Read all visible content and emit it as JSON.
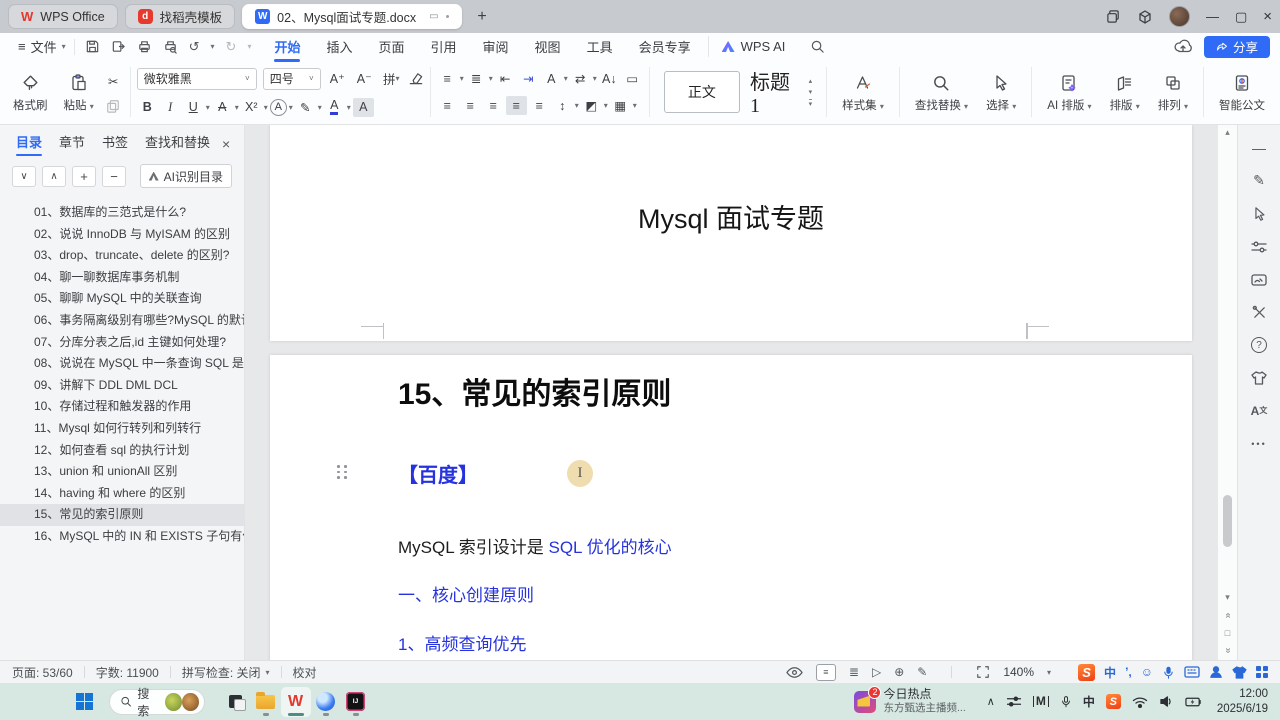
{
  "titlebar": {
    "tabs": [
      {
        "label": "WPS Office",
        "active": false
      },
      {
        "label": "找稻壳模板",
        "active": false
      },
      {
        "label": "02、Mysql面试专题.docx",
        "active": true
      }
    ],
    "share_label": "分享"
  },
  "menubar": {
    "file_label": "文件",
    "items": [
      {
        "label": "开始",
        "active": true
      },
      {
        "label": "插入"
      },
      {
        "label": "页面"
      },
      {
        "label": "引用"
      },
      {
        "label": "审阅"
      },
      {
        "label": "视图"
      },
      {
        "label": "工具"
      },
      {
        "label": "会员专享"
      }
    ],
    "ai_label": "WPS AI"
  },
  "ribbon": {
    "format_painter": "格式刷",
    "paste": "粘贴",
    "font_name": "微软雅黑",
    "font_size": "四号",
    "bold": "B",
    "italic": "I",
    "underline": "U",
    "strike": "A",
    "superscript": "X²",
    "effect": "A",
    "color": "A",
    "shading": "A",
    "grow": "A⁺",
    "shrink": "A⁻",
    "pinyin": "拼",
    "style_normal": "正文",
    "style_heading": "标题 1",
    "style_set": "样式集",
    "find_replace": "查找替换",
    "select": "选择",
    "ai_layout": "AI 排版",
    "layout": "排版",
    "arrange": "排列",
    "smart_doc": "智能公文"
  },
  "sidebar": {
    "tabs": [
      {
        "label": "目录",
        "active": true
      },
      {
        "label": "章节"
      },
      {
        "label": "书签"
      },
      {
        "label": "查找和替换"
      }
    ],
    "ai_button": "AI识别目录",
    "toc_items": [
      {
        "label": "01、数据库的三范式是什么?"
      },
      {
        "label": "02、说说 InnoDB 与 MyISAM 的区别"
      },
      {
        "label": "03、drop、truncate、delete 的区别?"
      },
      {
        "label": "04、聊一聊数据库事务机制"
      },
      {
        "label": "05、聊聊 MySQL 中的关联查询"
      },
      {
        "label": "06、事务隔离级别有哪些?MySQL 的默认..."
      },
      {
        "label": "07、分库分表之后,id 主键如何处理?"
      },
      {
        "label": "08、说说在 MySQL 中一条查询 SQL 是..."
      },
      {
        "label": "09、讲解下 DDL DML DCL"
      },
      {
        "label": "10、存储过程和触发器的作用"
      },
      {
        "label": "11、Mysql 如何行转列和列转行"
      },
      {
        "label": "12、如何查看 sql 的执行计划"
      },
      {
        "label": "13、union 和 unionAll 区别"
      },
      {
        "label": "14、having 和 where 的区别"
      },
      {
        "label": "15、常见的索引原则",
        "selected": true
      },
      {
        "label": "16、MySQL 中的 IN 和 EXISTS 子句有什..."
      }
    ]
  },
  "document": {
    "page1_title": "Mysql 面试专题",
    "heading": "15、常见的索引原则",
    "source_tag": "【百度】",
    "body_prefix": "MySQL 索引设计是 ",
    "body_link": "SQL 优化的核心",
    "section": "一、核心创建原则",
    "subsection": "1、高频查询优先",
    "cursor_glyph": "I"
  },
  "statusbar": {
    "page_info": "页面: 53/60",
    "word_count": "字数: 11900",
    "spellcheck": "拼写检查: 关闭",
    "proofread": "校对",
    "zoom": "140%",
    "ime_mode": "中",
    "ime_punct": "’,",
    "sogou_s": "S"
  },
  "taskbar": {
    "search_placeholder": "搜索",
    "widget_title": "今日热点",
    "widget_subtitle": "东方甄选主播频...",
    "badge": "2",
    "ime_mode": "中",
    "m_icon": "M",
    "sogou_s": "S",
    "time": "12:00",
    "date": "2025/6/19"
  },
  "glyphs": {
    "hamburger": "≡",
    "chevron_down": "▾",
    "chevron_up": "▴",
    "chevron_small": "˅",
    "minimize": "—",
    "maximize": "▢",
    "close": "×",
    "plus": "+",
    "undo": "↺",
    "redo": "↻",
    "cut": "✂",
    "play": "▷",
    "globe": "⊕",
    "pencil": "✎",
    "smiley": "☺",
    "up_caret": "∧",
    "down_caret": "∨",
    "plus_btn": "+",
    "minus_btn": "−",
    "more_dots": "•••",
    "dash": "—",
    "session": "▭",
    "dot": "•",
    "page_up": "«",
    "page_down": "»",
    "square": "□",
    "outline": "≣",
    "bullets": "≡",
    "numbers": "≣",
    "indent_l": "⇤",
    "indent_r": "⇥",
    "sort": "A↓",
    "frame": "▭",
    "align": "≡",
    "linesp": "↕",
    "border": "▦",
    "shade_ic": "◩",
    "wps_w": "W",
    "docer_d": "d",
    "doc_w": "W",
    "idea": "IJ",
    "question": "?"
  },
  "colors": {
    "accent_blue": "#2f6bf6",
    "doc_link_blue": "#2633dd",
    "sogou_orange": "#ef3f12",
    "taskbar_mint": "#d7e7e2"
  }
}
